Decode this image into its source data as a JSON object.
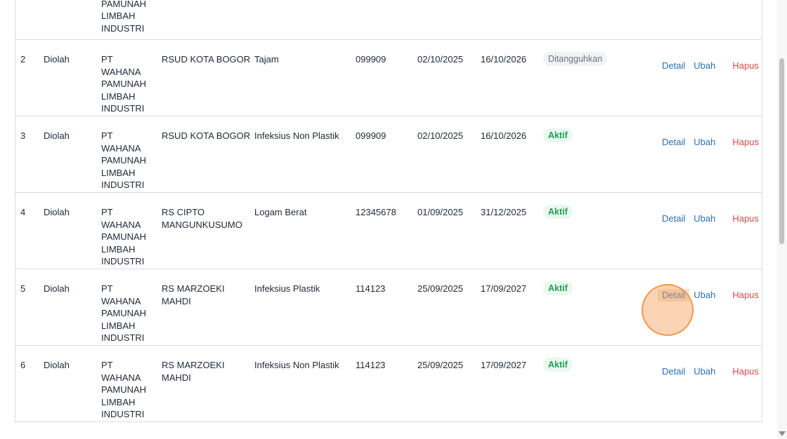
{
  "actions": {
    "detail": "Detail",
    "edit": "Ubah",
    "delete": "Hapus"
  },
  "rows": [
    {
      "no": "",
      "category": "",
      "transporter": "WAHANA\nPAMUNAH\nLIMBAH\nINDUSTRI",
      "producer": "",
      "waste_type": "",
      "number": "",
      "start": "",
      "end": "",
      "status": "",
      "status_kind": "partial"
    },
    {
      "no": "2",
      "category": "Diolah",
      "transporter": "PT\nWAHANA\nPAMUNAH\nLIMBAH\nINDUSTRI",
      "producer": "RSUD KOTA BOGOR",
      "waste_type": "Tajam",
      "number": "099909",
      "start": "02/10/2025",
      "end": "16/10/2026",
      "status": "Ditangguhkan",
      "status_kind": "susp"
    },
    {
      "no": "3",
      "category": "Diolah",
      "transporter": "PT\nWAHANA\nPAMUNAH\nLIMBAH\nINDUSTRI",
      "producer": "RSUD KOTA BOGOR",
      "waste_type": "Infeksius Non Plastik",
      "number": "099909",
      "start": "02/10/2025",
      "end": "16/10/2026",
      "status": "Aktif",
      "status_kind": "aktif"
    },
    {
      "no": "4",
      "category": "Diolah",
      "transporter": "PT\nWAHANA\nPAMUNAH\nLIMBAH\nINDUSTRI",
      "producer": "RS CIPTO\nMANGUNKUSUMO",
      "waste_type": "Logam Berat",
      "number": "12345678",
      "start": "01/09/2025",
      "end": "31/12/2025",
      "status": "Aktif",
      "status_kind": "aktif"
    },
    {
      "no": "5",
      "category": "Diolah",
      "transporter": "PT\nWAHANA\nPAMUNAH\nLIMBAH\nINDUSTRI",
      "producer": "RS MARZOEKI\nMAHDI",
      "waste_type": "Infeksius Plastik",
      "number": "114123",
      "start": "25/09/2025",
      "end": "17/09/2027",
      "status": "Aktif",
      "status_kind": "aktif"
    },
    {
      "no": "6",
      "category": "Diolah",
      "transporter": "PT\nWAHANA\nPAMUNAH\nLIMBAH\nINDUSTRI",
      "producer": "RS MARZOEKI\nMAHDI",
      "waste_type": "Infeksius Non Plastik",
      "number": "114123",
      "start": "25/09/2025",
      "end": "17/09/2027",
      "status": "Aktif",
      "status_kind": "aktif"
    }
  ]
}
